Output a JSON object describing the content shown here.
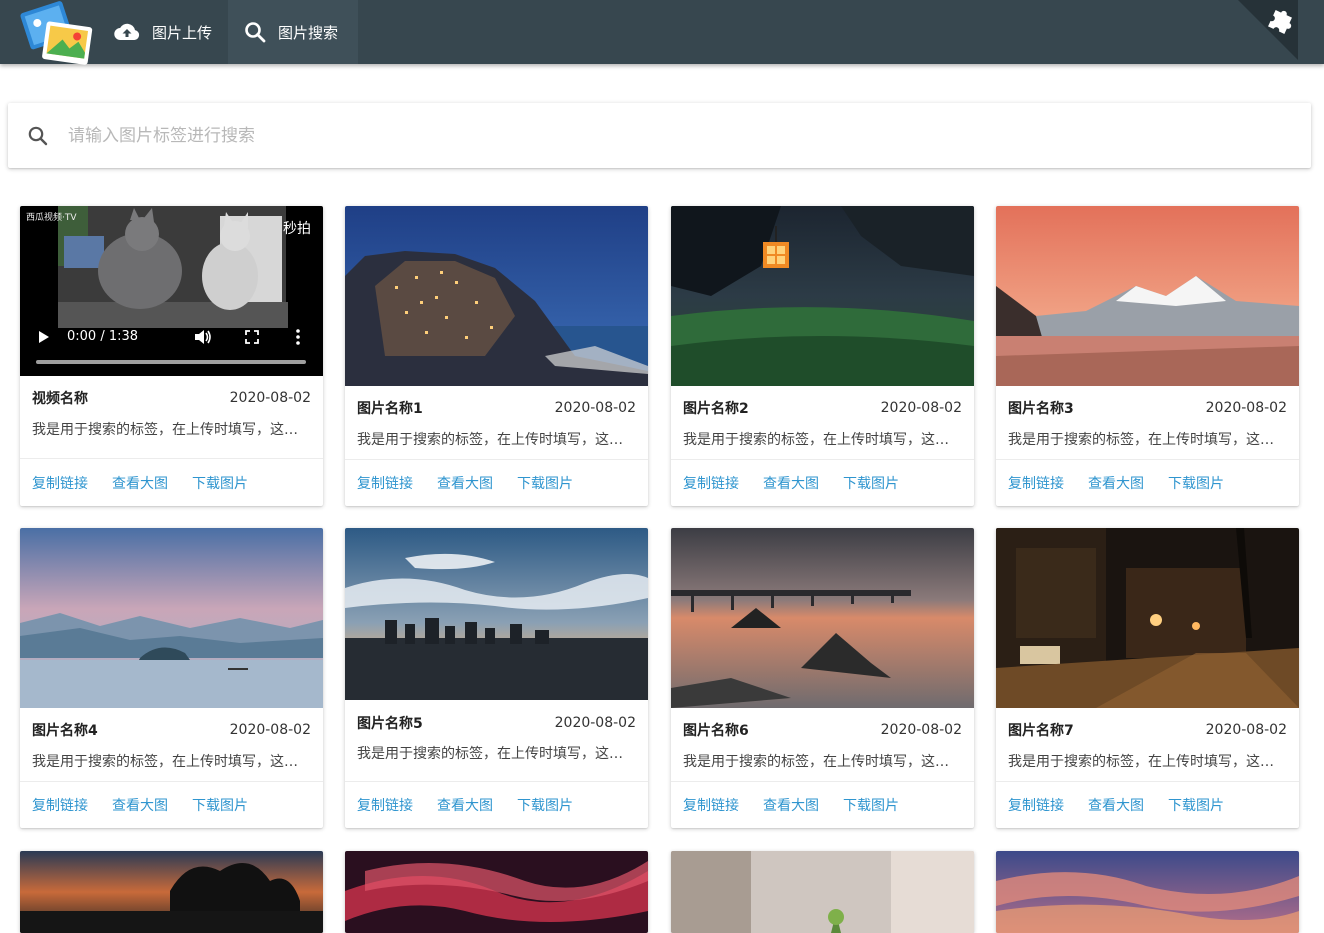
{
  "header": {
    "nav": [
      {
        "label": "图片上传",
        "icon": "cloud-upload-icon"
      },
      {
        "label": "图片搜索",
        "icon": "search-icon"
      }
    ],
    "logo_icon": "gallery-logo-icon",
    "corner_icon": "puzzle-icon",
    "background": "#37474f"
  },
  "search": {
    "placeholder": "请输入图片标签进行搜索",
    "value": ""
  },
  "accent": "#2f95cf",
  "cards": [
    {
      "title": "视频名称",
      "date": "2020-08-02",
      "desc": "我是用于搜索的标签，在上传时填写，这里是描述",
      "type": "video",
      "video": {
        "time": "0:00 / 1:38",
        "watermark_left": "西瓜视频·TV",
        "watermark_right": "秒拍",
        "progress": 0
      }
    },
    {
      "title": "图片名称1",
      "date": "2020-08-02",
      "desc": "我是用于搜索的标签，在上传时填写，这里是描述",
      "type": "image",
      "scene": "coast-village-dusk"
    },
    {
      "title": "图片名称2",
      "date": "2020-08-02",
      "desc": "我是用于搜索的标签，在上传时填写，这里是描述",
      "type": "image",
      "scene": "forest-lantern"
    },
    {
      "title": "图片名称3",
      "date": "2020-08-02",
      "desc": "我是用于搜索的标签，在上传时填写，这里是描述",
      "type": "image",
      "scene": "snow-mountain-sunset"
    },
    {
      "title": "图片名称4",
      "date": "2020-08-02",
      "desc": "我是用于搜索的标签，在上传时填写，这里是描述",
      "type": "image",
      "scene": "misty-lake"
    },
    {
      "title": "图片名称5",
      "date": "2020-08-02",
      "desc": "我是用于搜索的标签，在上传时填写，这里是描述",
      "type": "image",
      "scene": "city-sunset-clouds"
    },
    {
      "title": "图片名称6",
      "date": "2020-08-02",
      "desc": "我是用于搜索的标签，在上传时填写，这里是描述",
      "type": "image",
      "scene": "pier-sea-sunset"
    },
    {
      "title": "图片名称7",
      "date": "2020-08-02",
      "desc": "我是用于搜索的标签，在上传时填写，这里是描述",
      "type": "image",
      "scene": "night-street"
    }
  ],
  "actions": {
    "copy": "复制链接",
    "view": "查看大图",
    "download": "下载图片"
  }
}
